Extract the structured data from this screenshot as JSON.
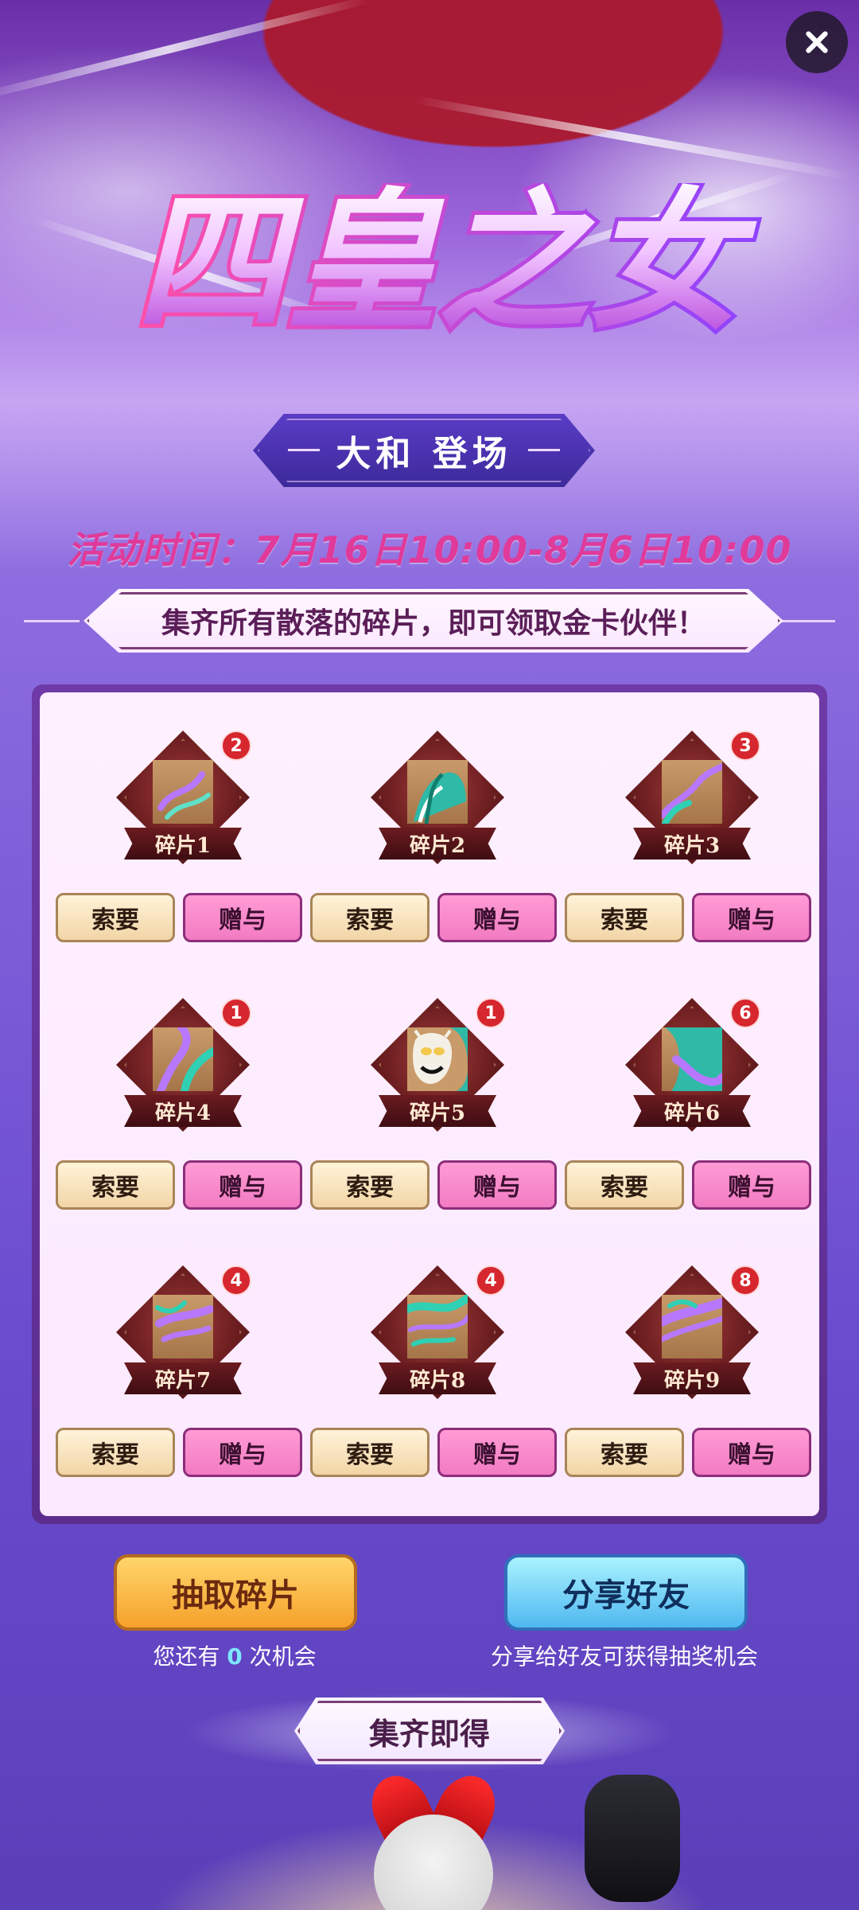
{
  "header": {
    "close_icon": "close-icon",
    "title": "四皇之女",
    "subtitle": "大和 登场",
    "event_time": "活动时间：7月16日10:00-8月6日10:00",
    "banner_text": "集齐所有散落的碎片，即可领取金卡伙伴！"
  },
  "fragments": {
    "items": [
      {
        "label": "碎片1",
        "count": "2"
      },
      {
        "label": "碎片2",
        "count": ""
      },
      {
        "label": "碎片3",
        "count": "3"
      },
      {
        "label": "碎片4",
        "count": "1"
      },
      {
        "label": "碎片5",
        "count": "1"
      },
      {
        "label": "碎片6",
        "count": "6"
      },
      {
        "label": "碎片7",
        "count": "4"
      },
      {
        "label": "碎片8",
        "count": "4"
      },
      {
        "label": "碎片9",
        "count": "8"
      }
    ],
    "ask_label": "索要",
    "gift_label": "赠与"
  },
  "actions": {
    "draw_label": "抽取碎片",
    "share_label": "分享好友",
    "draw_note_prefix": "您还有",
    "draw_count": "0",
    "draw_note_suffix": "次机会",
    "share_note": "分享给好友可获得抽奖机会"
  },
  "footer": {
    "collect_label": "集齐即得"
  },
  "colors": {
    "accent_pink": "#e03a9a",
    "panel_purple": "#6f3aa7",
    "draw_button": "#f6a12b",
    "share_button": "#4fb8f0",
    "badge_red": "#d6262e"
  }
}
